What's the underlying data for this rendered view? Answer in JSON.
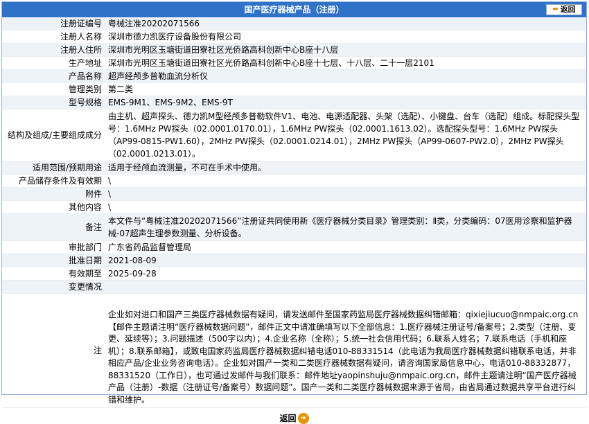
{
  "header": {
    "title": "国产医疗器械产品（注册）",
    "back_label": "返回"
  },
  "rows": [
    {
      "label": "注册证编号",
      "value": "粤械注准20202071566"
    },
    {
      "label": "注册人名称",
      "value": "深圳市德力凯医疗设备股份有限公司"
    },
    {
      "label": "注册人住所",
      "value": "深圳市光明区玉塘街道田寮社区光侨路高科创新中心B座十八层"
    },
    {
      "label": "生产地址",
      "value": "深圳市光明区玉塘街道田寮社区光侨路高科创新中心B座十七层、十八层、二十一层2101"
    },
    {
      "label": "产品名称",
      "value": "超声经颅多普勒血流分析仪"
    },
    {
      "label": "管理类别",
      "value": "第二类"
    },
    {
      "label": "型号规格",
      "value": "EMS-9M1、EMS-9M2、EMS-9T"
    },
    {
      "label": "结构及组成/主要组成成分",
      "value": "由主机、超声探头、德力凯M型经颅多普勒软件V1、电池、电源适配器、头架（选配）、小键盘、台车（选配）组成。标配探头型号：1.6MHz PW探头（02.0001.0170.01），1.6MHz PW探头（02.0001.1613.02）。选配探头型号：1.6MHz PW探头（AP99-0815-PW1.60），2MHz PW探头（02.0001.0214.01），2MHz PW探头（AP99-0607-PW2.0），2MHz PW探头（02.0001.0213.01）。"
    },
    {
      "label": "适用范围/预期用途",
      "value": "适用于经颅血流测量，不可在手术中使用。"
    },
    {
      "label": "产品储存条件及有效期",
      "value": "\\"
    },
    {
      "label": "附件",
      "value": "\\"
    },
    {
      "label": "其他内容",
      "value": "\\"
    },
    {
      "label": "备注",
      "value": "本文件与“粤械注准20202071566”注册证共同使用新《医疗器械分类目录》管理类别：Ⅱ类，分类编码：07医用诊察和监护器械-07超声生理参数测量、分析设备。"
    },
    {
      "label": "审批部门",
      "value": "广东省药品监督管理局"
    },
    {
      "label": "批准日期",
      "value": "2021-08-09"
    },
    {
      "label": "有效期至",
      "value": "2025-09-28"
    },
    {
      "label": "变更情况",
      "value": ""
    }
  ],
  "note": {
    "label": "注",
    "text": "企业如对进口和国产三类医疗器械数据有疑问，请发送邮件至国家药监局医疗器械数据纠错邮箱：qixiejiucuo@nmpaic.org.cn【邮件主题请注明“医疗器械数据问题”，邮件正文中请准确填写以下全部信息：1.医疗器械注册证号/备案号；2.类型（注册、变更、延续等）；3.问题描述（500字以内）；4.企业名称（全称）；5.统一社会信用代码；6.联系人姓名；7.联系电话（手机和座机）；8.联系邮箱】，或致电国家药监局医疗器械数据纠错电话010-88331514（此电话为我局医疗器械数据纠错联系电话，并非相应产品/企业业务咨询电话）。企业如对国产一类和二类医疗器械数据有疑问，请咨询国家局信息中心，电话010-88332877，88331520（工作日），也可通过发邮件与我们联系：邮件地址yaopinshuju@nmpaic.org.cn，邮件主题请注明“国产医疗器械产品（注册）-数据（注册证号/备案号）数据问题”。国产一类和二类医疗器械数据来源于省局，由省局通过数据共享平台进行纠错和维护。"
  },
  "footer": {
    "back_label": "返回"
  }
}
